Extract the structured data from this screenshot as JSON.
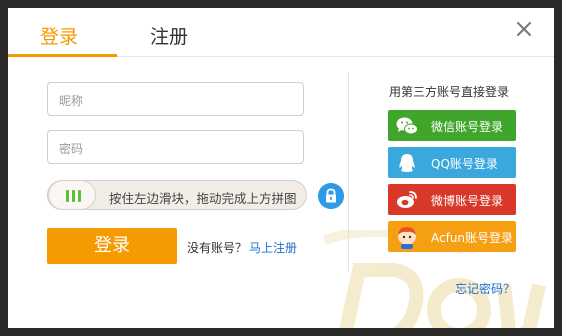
{
  "tabs": {
    "login": "登录",
    "register": "注册"
  },
  "form": {
    "nickname_placeholder": "昵称",
    "password_placeholder": "密码",
    "slider_text": "按住左边滑块，拖动完成上方拼图",
    "login_button": "登录",
    "no_account_text": "没有账号？",
    "register_link": "马上注册"
  },
  "third_party": {
    "title": "用第三方账号直接登录",
    "buttons": [
      {
        "label": "微信账号登录",
        "icon": "wechat-icon",
        "color": "#3fa62b"
      },
      {
        "label": "QQ账号登录",
        "icon": "qq-icon",
        "color": "#3aa7dd"
      },
      {
        "label": "微博账号登录",
        "icon": "weibo-icon",
        "color": "#d8382a"
      },
      {
        "label": "Acfun账号登录",
        "icon": "acfun-icon",
        "color": "#f5a012"
      }
    ]
  },
  "forgot_password": "忘记密码？",
  "colors": {
    "accent": "#f59a00",
    "link": "#1e6fd0"
  }
}
